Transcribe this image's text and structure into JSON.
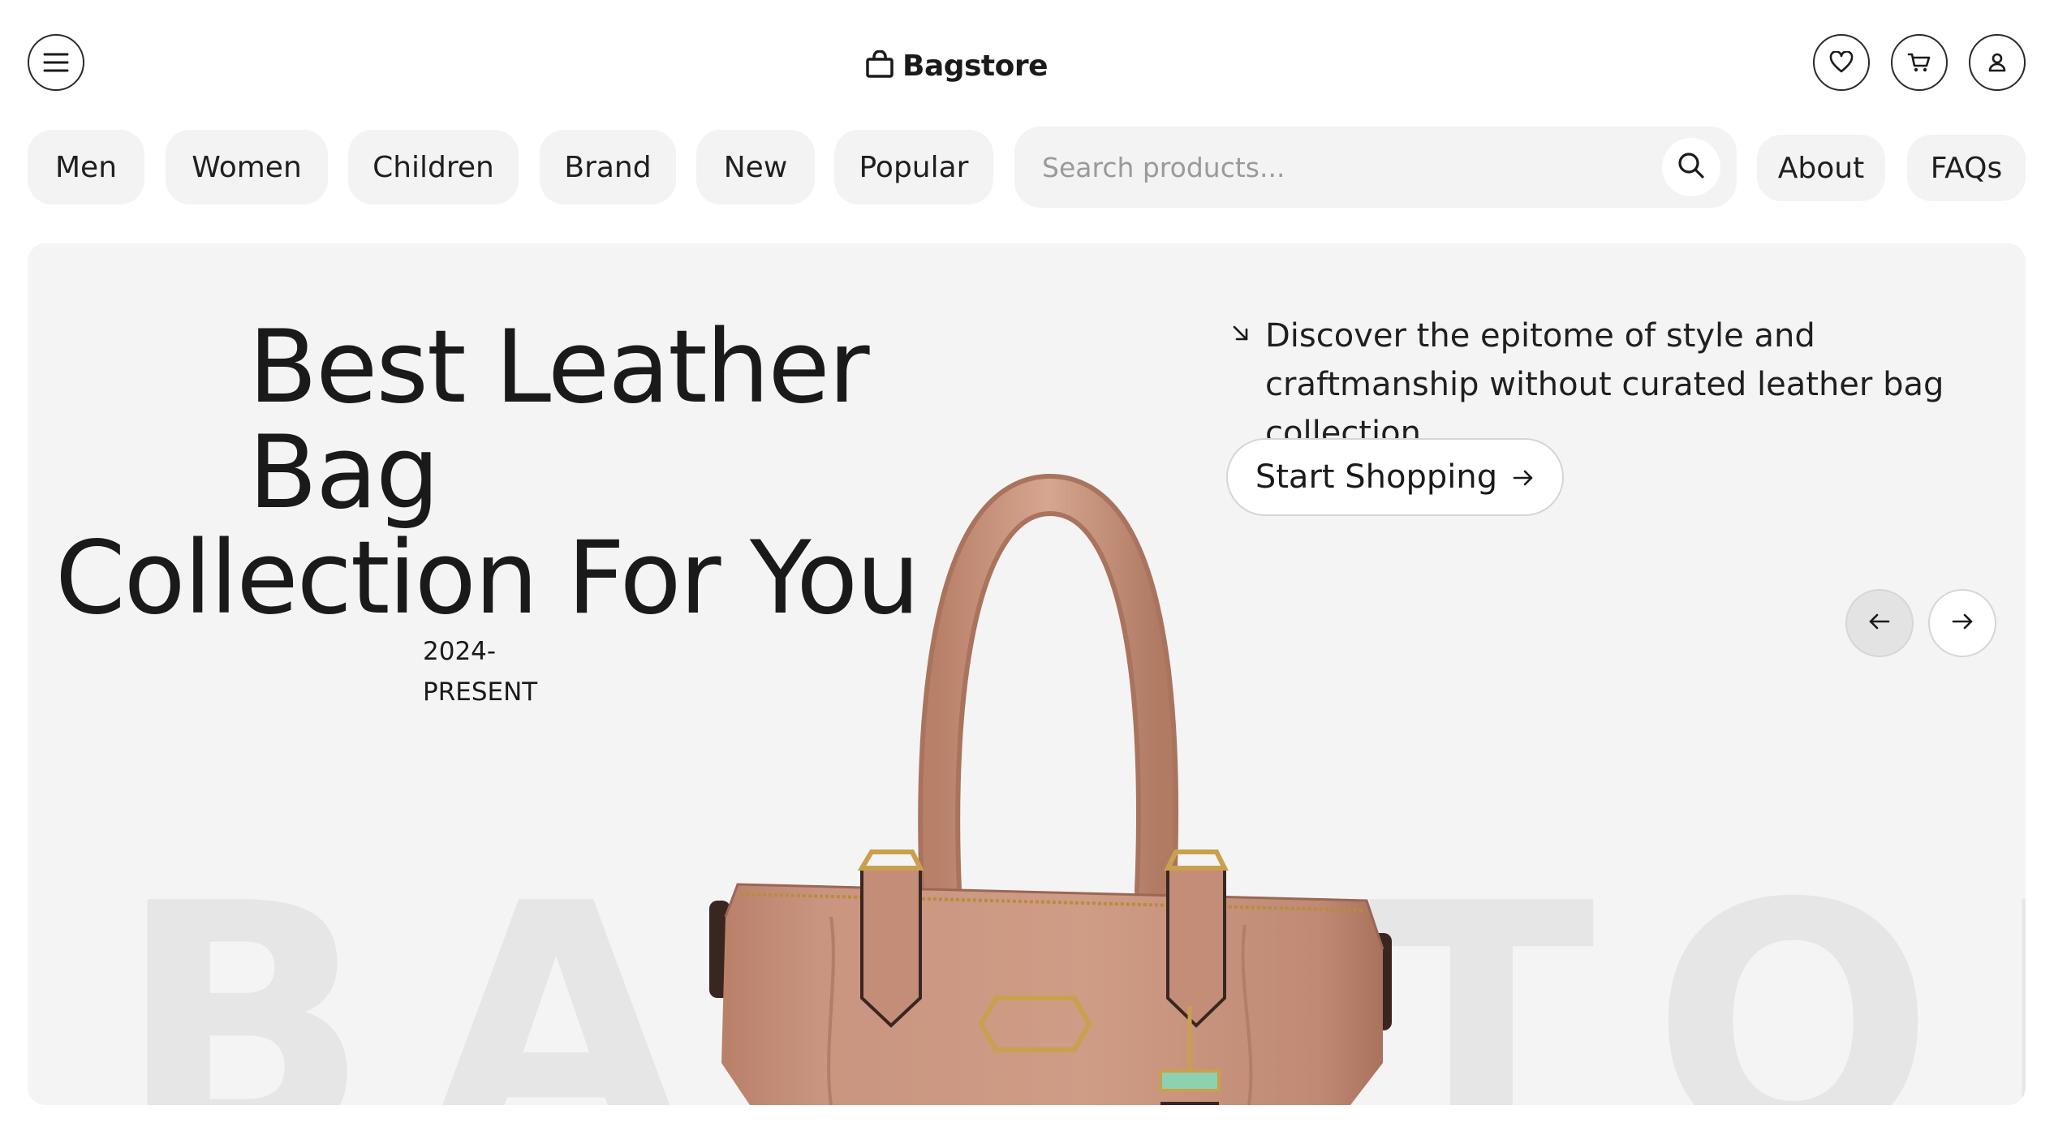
{
  "brand": {
    "name": "Bagstore"
  },
  "header": {
    "menu_icon": "hamburger-menu-icon",
    "actions": [
      {
        "icon": "heart-icon"
      },
      {
        "icon": "cart-icon"
      },
      {
        "icon": "user-icon"
      }
    ]
  },
  "nav": {
    "categories": [
      "Men",
      "Women",
      "Children",
      "Brand",
      "New",
      "Popular"
    ],
    "search": {
      "placeholder": "Search products...",
      "value": ""
    },
    "links": [
      "About",
      "FAQs"
    ]
  },
  "hero": {
    "title_line1": "Best Leather Bag",
    "title_line2": "Collection For You",
    "year_line1": "2024-",
    "year_line2": "PRESENT",
    "description": "Discover the epitome of style and craftmanship without curated leather bag collection",
    "cta_label": "Start Shopping",
    "watermark": "BAGSTORE",
    "product_color": "#c99580"
  },
  "colors": {
    "text": "#1a1a1a",
    "pill_bg": "#f3f3f3",
    "hero_bg": "#f4f4f4",
    "watermark": "#e6e6e6",
    "accent_tag": "#8ed1b0"
  }
}
